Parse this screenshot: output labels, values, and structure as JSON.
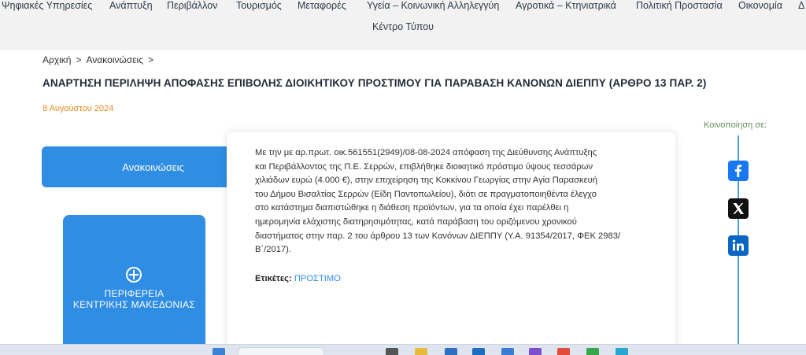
{
  "top_nav": {
    "items": [
      "Ψηφιακές Υπηρεσίες",
      "Ανάπτυξη",
      "Περιβάλλον",
      "Τουρισμός",
      "Μεταφορές",
      "Υγεία – Κοινωνική Αλληλεγγύη",
      "Αγροτικά – Κτηνιατρικά",
      "Πολιτική Προστασία",
      "Οικονομία",
      "Δ"
    ],
    "row2_item": "Κέντρο Τύπου"
  },
  "breadcrumb": {
    "items": [
      "Αρχική",
      "Ανακοινώσεις"
    ],
    "separator": ">"
  },
  "page": {
    "title": "ΑΝΑΡΤΗΣΗ ΠΕΡΙΛΗΨΗ ΑΠΟΦΑΣΗΣ ΕΠΙΒΟΛΗΣ ΔΙΟΙΚΗΤΙΚΟΥ ΠΡΟΣΤΙΜΟΥ ΓΙΑ ΠΑΡΑΒΑΣΗ ΚΑΝΟΝΩΝ ΔΙΕΠΠΥ (ΑΡΘΡΟ 13 ΠΑΡ. 2)",
    "date": "8 Αυγούστου 2024"
  },
  "sidebar": {
    "announcements_button": "Ανακοινώσεις",
    "logo_line1": "ΠΕΡΙΦΕΡΕΙΑ",
    "logo_line2": "ΚΕΝΤΡΙΚΗΣ ΜΑΚΕΔΟΝΙΑΣ"
  },
  "article": {
    "body": [
      "Με την με αρ.πρωτ.  οικ.561551(2949)/08-08-2024 απόφαση της Διεύθυνσης Ανάπτυξης",
      "και Περιβάλλοντος της Π.Ε. Σερρών, επιβλήθηκε διοικητικό πρόστιμο ύψους τεσσάρων",
      "χιλιάδων ευρώ (4.000 €), στην επιχείρηση της Κοκκίνου Γεωργίας στην Αγία Παρασκευή",
      "του Δήμου Βισαλτίας Σερρών (Είδη Παντοπωλείου), διότι σε πραγματοποιηθέντα έλεγχο",
      "στο κατάστημα διαπιστώθηκε η διάθεση προϊόντων, για τα οποία έχει παρέλθει η",
      "ημερομηνία ελάχιστης διατηρησιμότητας, κατά παράβαση του οριζόμενου χρονικού",
      "διαστήματος στην παρ. 2 του άρθρου 13 των Κανόνων ΔΙΕΠΠΥ (Υ.Α. 91354/2017, ΦΕΚ 2983/",
      "Β΄/2017)."
    ],
    "tags_label": "Ετικέτες:",
    "tag": "ΠΡΟΣΤΙΜΟ"
  },
  "share": {
    "label": "Κοινοποίηση σε:",
    "icons": [
      "facebook-icon",
      "x-icon",
      "linkedin-icon"
    ]
  },
  "colors": {
    "accent_blue": "#2f8de4",
    "date_orange": "#e58a1f",
    "share_label_green": "#6b8a63"
  }
}
